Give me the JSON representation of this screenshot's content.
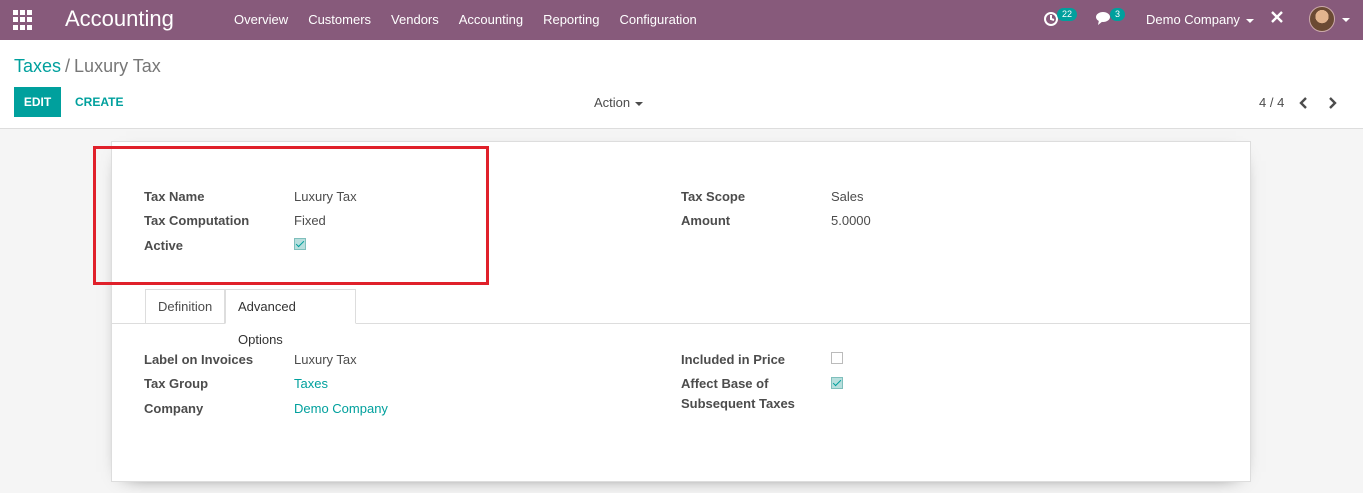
{
  "navbar": {
    "app_title": "Accounting",
    "menu": [
      "Overview",
      "Customers",
      "Vendors",
      "Accounting",
      "Reporting",
      "Configuration"
    ],
    "activity_count": "22",
    "messages_count": "3",
    "company": "Demo Company",
    "icons": [
      "apps-grid-icon",
      "activity-clock-icon",
      "chat-icon",
      "debug-tools-icon",
      "user-avatar"
    ]
  },
  "breadcrumb": {
    "parent": "Taxes",
    "separator": "/",
    "current": "Luxury Tax"
  },
  "controls": {
    "edit_label": "EDIT",
    "create_label": "CREATE",
    "action_label": "Action",
    "pager": "4 / 4",
    "prev_glyph": "‹",
    "next_glyph": "›"
  },
  "form": {
    "left": [
      {
        "label": "Tax Name",
        "value": "Luxury Tax"
      },
      {
        "label": "Tax Computation",
        "value": "Fixed"
      },
      {
        "label": "Active",
        "checked": true
      }
    ],
    "right": [
      {
        "label": "Tax Scope",
        "value": "Sales"
      },
      {
        "label": "Amount",
        "value": "5.0000"
      }
    ]
  },
  "tabs": [
    {
      "label": "Definition",
      "active": false
    },
    {
      "label": "Advanced Options",
      "active": true
    }
  ],
  "advanced": {
    "left": [
      {
        "label": "Label on Invoices",
        "value": "Luxury Tax"
      },
      {
        "label": "Tax Group",
        "value": "Taxes"
      },
      {
        "label": "Company",
        "value": "Demo Company"
      }
    ],
    "right": [
      {
        "label": "Included in Price",
        "checked": false
      },
      {
        "label_line1": "Affect Base of",
        "label_line2": "Subsequent Taxes",
        "checked": true
      }
    ]
  },
  "colors": {
    "navbar": "#875a7b",
    "accent": "#00a09d",
    "highlight": "#e0202a"
  }
}
